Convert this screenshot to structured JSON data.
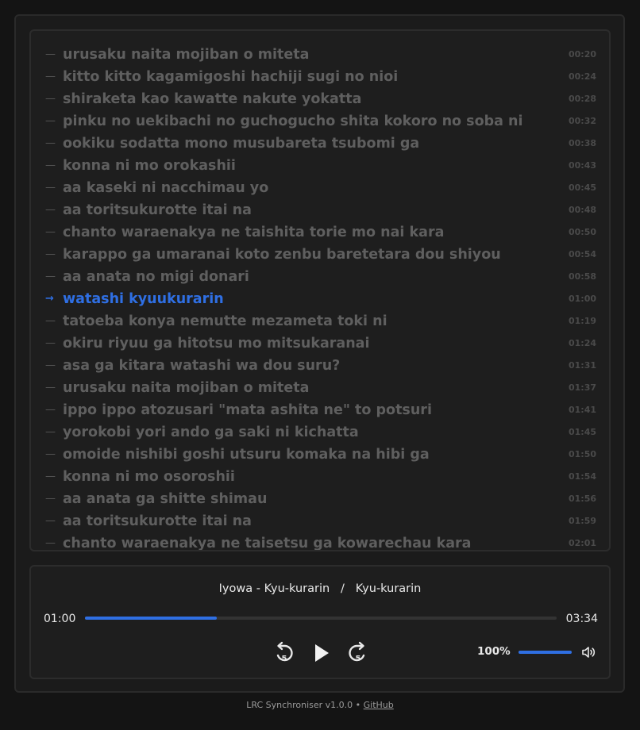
{
  "lyrics": [
    {
      "marker": "—",
      "text": "urusaku naita mojiban o miteta",
      "time": "00:20"
    },
    {
      "marker": "—",
      "text": "kitto kitto kagamigoshi hachiji sugi no nioi",
      "time": "00:24"
    },
    {
      "marker": "—",
      "text": "shiraketa kao kawatte nakute yokatta",
      "time": "00:28"
    },
    {
      "marker": "—",
      "text": "pinku no uekibachi no guchogucho shita kokoro no soba ni",
      "time": "00:32"
    },
    {
      "marker": "—",
      "text": "ookiku sodatta mono musubareta tsubomi ga",
      "time": "00:38"
    },
    {
      "marker": "—",
      "text": "konna ni mo orokashii",
      "time": "00:43"
    },
    {
      "marker": "—",
      "text": "aa kaseki ni nacchimau yo",
      "time": "00:45"
    },
    {
      "marker": "—",
      "text": "aa toritsukurotte itai na",
      "time": "00:48"
    },
    {
      "marker": "—",
      "text": "chanto waraenakya ne taishita torie mo nai kara",
      "time": "00:50"
    },
    {
      "marker": "—",
      "text": "karappo ga umaranai koto zenbu baretetara dou shiyou",
      "time": "00:54"
    },
    {
      "marker": "—",
      "text": "aa anata no migi donari",
      "time": "00:58"
    },
    {
      "marker": "→",
      "text": "watashi kyuukurarin",
      "time": "01:00",
      "active": true
    },
    {
      "marker": "—",
      "text": "tatoeba konya nemutte mezameta toki ni",
      "time": "01:19"
    },
    {
      "marker": "—",
      "text": "okiru riyuu ga hitotsu mo mitsukaranai",
      "time": "01:24"
    },
    {
      "marker": "—",
      "text": "asa ga kitara watashi wa dou suru?",
      "time": "01:31"
    },
    {
      "marker": "—",
      "text": "urusaku naita mojiban o miteta",
      "time": "01:37"
    },
    {
      "marker": "—",
      "text": "ippo ippo atozusari \"mata ashita ne\" to potsuri",
      "time": "01:41"
    },
    {
      "marker": "—",
      "text": "yorokobi yori ando ga saki ni kichatta",
      "time": "01:45"
    },
    {
      "marker": "—",
      "text": "omoide nishibi goshi utsuru komaka na hibi ga",
      "time": "01:50"
    },
    {
      "marker": "—",
      "text": "konna ni mo osoroshii",
      "time": "01:54"
    },
    {
      "marker": "—",
      "text": "aa anata ga shitte shimau",
      "time": "01:56"
    },
    {
      "marker": "—",
      "text": "aa toritsukurotte itai na",
      "time": "01:59"
    },
    {
      "marker": "—",
      "text": "chanto waraenakya ne taisetsu ga kowarechau kara",
      "time": "02:01"
    }
  ],
  "player": {
    "track": "Iyowa - Kyu-kurarin   /   Kyu-kurarin",
    "current_time": "01:00",
    "total_time": "03:34",
    "progress": 0.28,
    "volume_label": "100%",
    "volume": 1.0,
    "icons": {
      "rewind": "rewind-5-icon",
      "play": "play-icon",
      "forward": "forward-5-icon",
      "volume": "volume-icon"
    }
  },
  "footer": {
    "text": "LRC Synchroniser v1.0.0 • ",
    "link": "GitHub"
  },
  "colors": {
    "accent": "#2f6fe3",
    "background": "#141414",
    "panel": "#1e1e1e",
    "lyric_inactive": "#5f5f5f"
  }
}
